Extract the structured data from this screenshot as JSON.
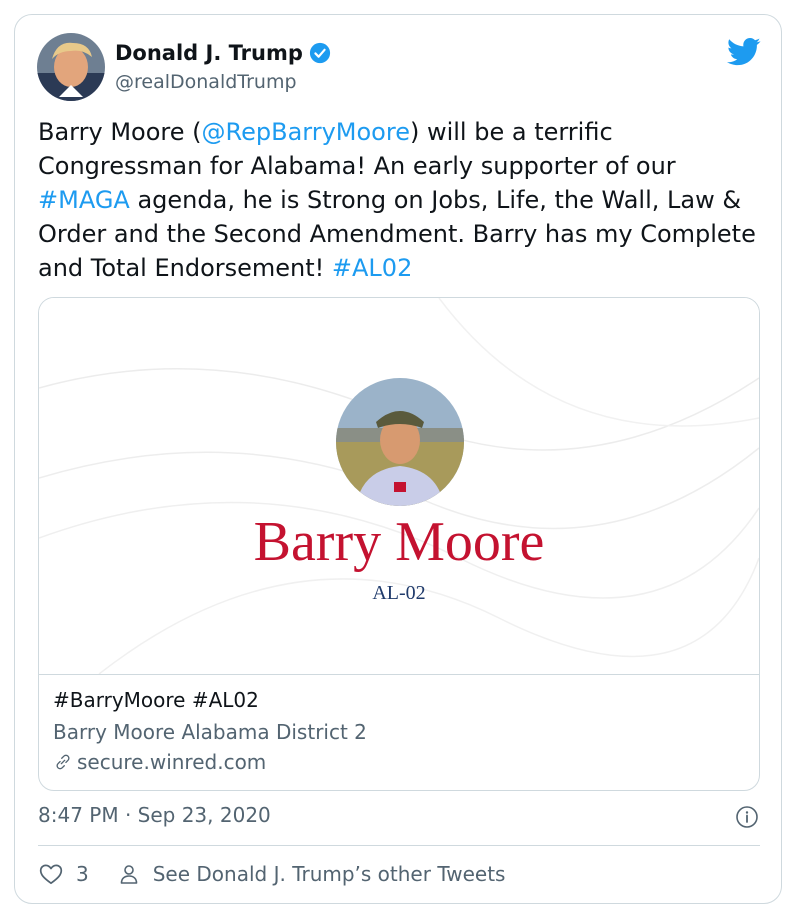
{
  "tweet": {
    "author_name": "Donald J. Trump",
    "author_handle": "@realDonaldTrump",
    "text": {
      "p1": "Barry Moore (",
      "mention": "@RepBarryMoore",
      "p2": ") will be a terrific Congressman for Alabama! An early supporter of our ",
      "hashtag1": "#MAGA",
      "p3": " agenda, he is Strong on Jobs, Life, the Wall, Law & Order and the Second Amendment. Barry has my Complete and Total Endorsement! ",
      "hashtag2": "#AL02"
    },
    "timestamp": "8:47 PM · Sep 23, 2020",
    "like_count": "3",
    "other_tweets_label": "See Donald J. Trump’s other Tweets"
  },
  "card": {
    "image_name": "Barry Moore",
    "image_district": "AL-02",
    "title": "#BarryMoore #AL02",
    "description": "Barry Moore Alabama District 2",
    "domain": "secure.winred.com"
  },
  "colors": {
    "link": "#1d9bf0",
    "secondary_text": "#536471",
    "border": "#cfd9de",
    "card_name_red": "#c41230",
    "card_district_navy": "#1f3a6b"
  },
  "icons": [
    "verified-badge-icon",
    "twitter-bird-icon",
    "link-icon",
    "info-icon",
    "heart-icon",
    "person-icon"
  ]
}
